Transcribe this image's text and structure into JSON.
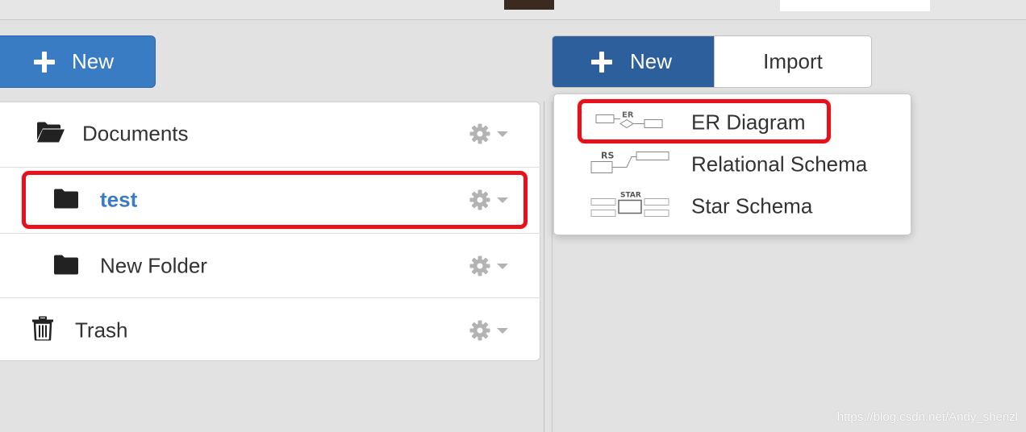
{
  "left_panel": {
    "new_button_label": "New",
    "items": [
      {
        "label": "Documents",
        "icon": "folder-open-icon"
      },
      {
        "label": "test",
        "icon": "folder-icon",
        "selected": true
      },
      {
        "label": "New Folder",
        "icon": "folder-icon"
      },
      {
        "label": "Trash",
        "icon": "trash-icon"
      }
    ]
  },
  "right_panel": {
    "new_button_label": "New",
    "import_button_label": "Import",
    "dropdown": {
      "items": [
        {
          "label": "ER Diagram",
          "thumb_text": "ER"
        },
        {
          "label": "Relational Schema",
          "thumb_text": "RS"
        },
        {
          "label": "Star Schema",
          "thumb_text": "STAR"
        }
      ]
    }
  },
  "colors": {
    "primary": "#3a7cc4",
    "primary_dark": "#2d5f9c",
    "selected_text": "#3a7cc4",
    "highlight": "#e8101b"
  },
  "watermark": "https://blog.csdn.net/Andy_shenzl"
}
